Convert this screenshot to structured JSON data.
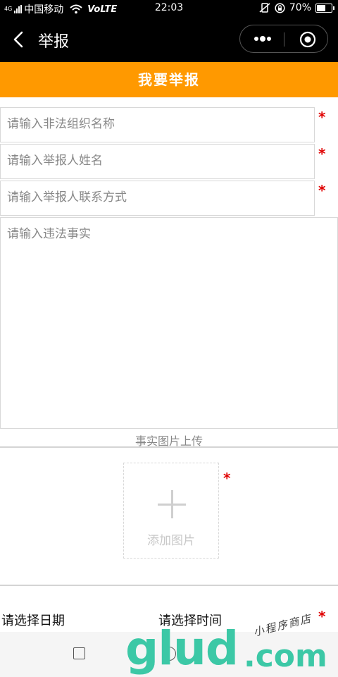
{
  "status_bar": {
    "network_indicator": "4G",
    "carrier": "中国移动",
    "volte": "VoLTE",
    "time": "22:03",
    "battery_percent": "70%",
    "battery_level": 0.7,
    "icons": [
      "signal-icon",
      "wifi-icon",
      "vibrate-icon",
      "lock-rotation-icon",
      "battery-icon"
    ]
  },
  "nav": {
    "title": "举报",
    "icons": [
      "back-icon",
      "more-dots-icon",
      "close-target-icon"
    ]
  },
  "banner": {
    "title": "我要举报"
  },
  "form": {
    "org_name_placeholder": "请输入非法组织名称",
    "reporter_name_placeholder": "请输入举报人姓名",
    "reporter_contact_placeholder": "请输入举报人联系方式",
    "facts_placeholder": "请输入违法事实",
    "required_mark": "*",
    "upload_label": "事实图片上传",
    "add_photo_label": "添加图片",
    "date_label": "请选择日期",
    "time_label": "请选择时间"
  },
  "watermark": {
    "main": "glud",
    "suffix": ".com",
    "script": "小程序商店"
  },
  "colors": {
    "banner": "#ff9900",
    "required": "#e00000",
    "watermark": "#3cc8a6"
  }
}
